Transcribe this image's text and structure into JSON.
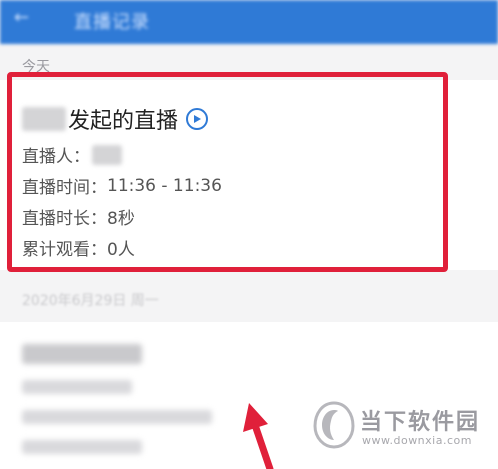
{
  "header": {
    "back_icon": "back-arrow-icon",
    "title": "直播记录",
    "color": "#2f7ad6"
  },
  "sections": [
    {
      "date": "今天",
      "record": {
        "title_suffix": "发起的直播",
        "host_label": "直播人：",
        "time_label": "直播时间：",
        "time_value": "11:36 - 11:36",
        "duration_label": "直播时长：",
        "duration_value": "8秒",
        "viewers_label": "累计观看：",
        "viewers_value": "0人"
      }
    },
    {
      "date": "2020年6月29日 周一"
    }
  ],
  "highlight_color": "#e0203a",
  "watermark": {
    "name": "当下软件园",
    "url": "www.downxia.com"
  }
}
